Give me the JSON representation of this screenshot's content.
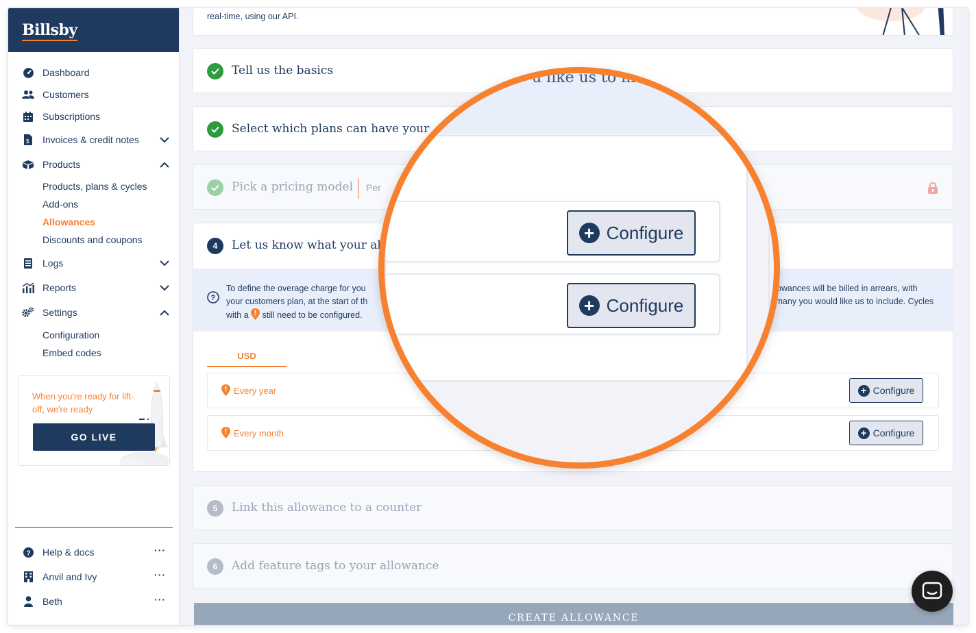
{
  "brand": {
    "name": "Billsby"
  },
  "sidebar": {
    "items": [
      {
        "label": "Dashboard",
        "icon": "dashboard-icon"
      },
      {
        "label": "Customers",
        "icon": "users-icon"
      },
      {
        "label": "Subscriptions",
        "icon": "calendar-icon"
      },
      {
        "label": "Invoices & credit notes",
        "icon": "invoice-icon",
        "expanded": false
      },
      {
        "label": "Products",
        "icon": "products-icon",
        "expanded": true
      },
      {
        "label": "Logs",
        "icon": "logs-icon",
        "expanded": false
      },
      {
        "label": "Reports",
        "icon": "reports-icon",
        "expanded": false
      },
      {
        "label": "Settings",
        "icon": "settings-icon",
        "expanded": true
      }
    ],
    "products_sub": [
      {
        "label": "Products, plans & cycles",
        "active": false
      },
      {
        "label": "Add-ons",
        "active": false
      },
      {
        "label": "Allowances",
        "active": true
      },
      {
        "label": "Discounts and coupons",
        "active": false
      }
    ],
    "settings_sub": [
      {
        "label": "Configuration"
      },
      {
        "label": "Embed codes"
      }
    ],
    "golive": {
      "text": "When you're ready for lift-off, we're ready",
      "button": "GO LIVE"
    },
    "footer": [
      {
        "label": "Help & docs",
        "icon": "help-icon",
        "more": "···"
      },
      {
        "label": "Anvil and Ivy",
        "icon": "building-icon",
        "more": "···"
      },
      {
        "label": "Beth",
        "icon": "user-icon",
        "more": "···"
      }
    ]
  },
  "main": {
    "intro_tail": "real-time, using our API.",
    "steps": {
      "basics": "Tell us the basics",
      "plans": "Select which plans can have your",
      "pricing": "Pick a pricing model",
      "pricing_value": "Per",
      "step4_num": "4",
      "step4": "Let us know what your al",
      "step5_num": "5",
      "step5": "Link this allowance to a counter",
      "step6_num": "6",
      "step6": "Add feature tags to your allowance"
    },
    "info": {
      "left_line1": "To define the overage charge for you",
      "left_line2": "your customers plan, at the start of th",
      "left_line3a": "with a",
      "left_line3b": "still need to be configured.",
      "right_line1": "Allowances will be billed in arrears, with",
      "right_line2": "w many you would like us to include. Cycles"
    },
    "currency_tab": "USD",
    "cycles": [
      {
        "label": "Every year",
        "button": "Configure"
      },
      {
        "label": "Every month",
        "button": "Configure"
      }
    ],
    "create_button": "CREATE ALLOWANCE"
  },
  "lens": {
    "header_fragment": "u like us to in",
    "buttons": [
      "Configure",
      "Configure"
    ]
  },
  "colors": {
    "navy": "#1e3a5f",
    "orange": "#f7812f",
    "green": "#2e9b3e",
    "info_band": "#e9effa",
    "background": "#f1f3f9"
  }
}
